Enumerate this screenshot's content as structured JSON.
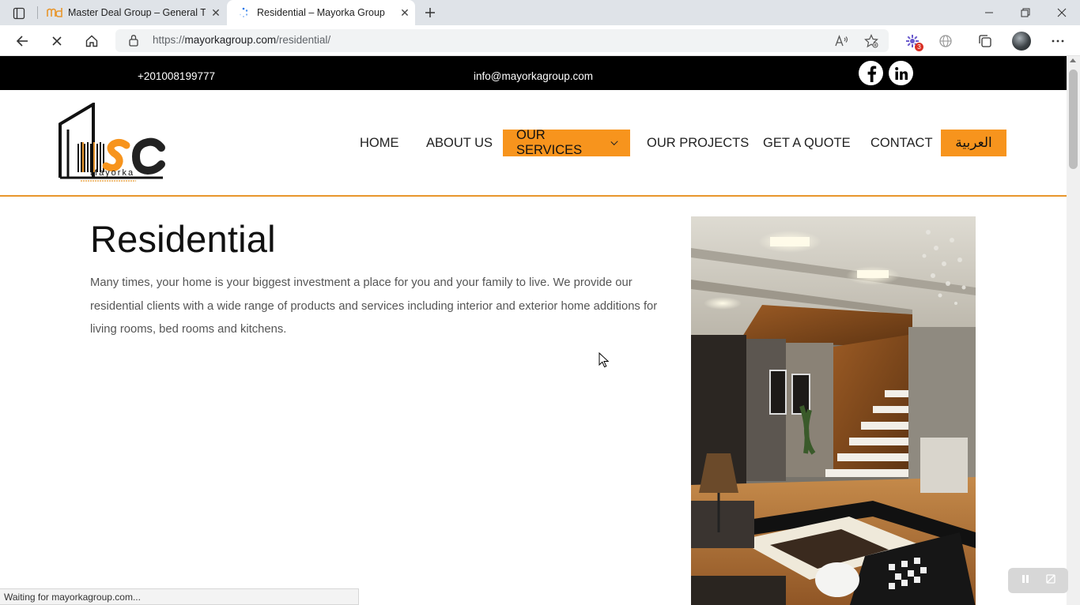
{
  "browser": {
    "tabs": [
      {
        "title": "Master Deal Group – General Tra",
        "active": false
      },
      {
        "title": "Residential – Mayorka Group",
        "active": true
      }
    ],
    "url_prefix": "https://",
    "url_domain": "mayorkagroup.com",
    "url_path": "/residential/",
    "extension_badge": "3",
    "status_text": "Waiting for mayorkagroup.com..."
  },
  "site": {
    "phone": "+201008199777",
    "email": "info@mayorkagroup.com",
    "social": [
      "facebook-icon",
      "linkedin-icon"
    ],
    "logo_text": "Mayorka",
    "nav": [
      {
        "label": "HOME"
      },
      {
        "label": "ABOUT US"
      },
      {
        "label": "OUR SERVICES",
        "active": true
      },
      {
        "label": "OUR PROJECTS"
      },
      {
        "label": "GET A QUOTE"
      },
      {
        "label": "CONTACT"
      },
      {
        "label": "العربية"
      }
    ],
    "accent_color": "#f7941d"
  },
  "content": {
    "title": "Residential",
    "body": "Many times, your home is your biggest investment a place for you and your family to live. We provide our residential clients with a wide range of products and services including interior and exterior home additions for living rooms, bed rooms and kitchens."
  }
}
